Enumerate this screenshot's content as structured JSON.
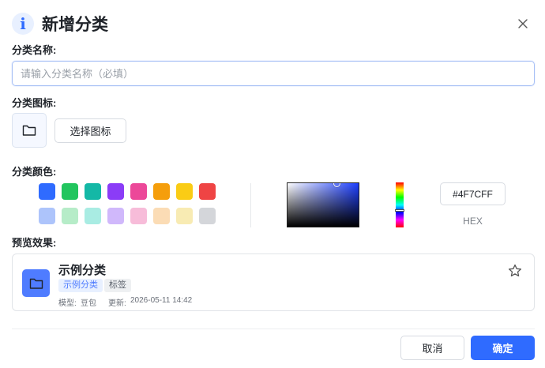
{
  "dialog": {
    "title": "新增分类",
    "info_icon": "i",
    "close_icon": "close-icon"
  },
  "name_field": {
    "label": "分类名称:",
    "placeholder": "请输入分类名称（必填）",
    "value": ""
  },
  "icon_field": {
    "label": "分类图标:",
    "selected_icon": "folder-icon",
    "choose_button": "选择图标"
  },
  "color_field": {
    "label": "分类颜色:",
    "swatches_row1": [
      "#2f6bff",
      "#22c55e",
      "#14b8a6",
      "#8b3cf7",
      "#ec4899",
      "#f59e0b",
      "#facc15",
      "#ef4444"
    ],
    "swatches_row2": [
      "#adc4fb",
      "#b6ecc8",
      "#a9ece3",
      "#d0b8fb",
      "#f7bcd9",
      "#fbdcb5",
      "#f8ebb3",
      "#d4d6da"
    ],
    "hex_value": "#4F7CFF",
    "hex_label": "HEX"
  },
  "preview": {
    "label": "预览效果:",
    "name": "示例分类",
    "tag_category": "示例分类",
    "tag_label": "标签",
    "model_label": "模型:",
    "model_value": "豆包",
    "updated_label": "更新:",
    "updated_value": "2026-05-11 14:42",
    "icon_color": "#4f7cff"
  },
  "footer": {
    "cancel": "取消",
    "confirm": "确定"
  }
}
